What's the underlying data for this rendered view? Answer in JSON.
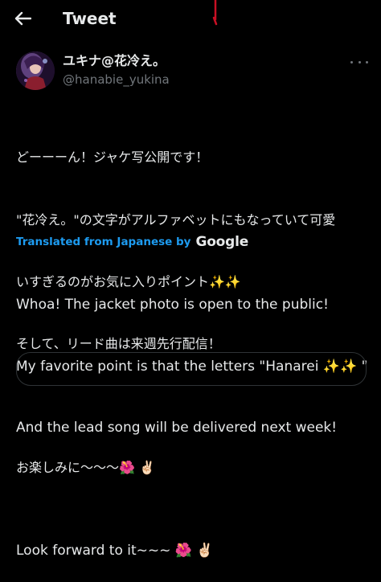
{
  "header": {
    "title": "Tweet",
    "back_icon": "arrow-left-icon"
  },
  "author": {
    "display_name": "ユキナ@花冷え。",
    "handle": "@hanabie_yukina"
  },
  "tweet": {
    "original_lines": [
      "どーーーん！ジャケ写公開です！",
      "\"花冷え。\"の文字がアルファベットにもなっていて可愛",
      "いすぎるのがお気に入りポイント✨✨",
      "そして、リード曲は来週先行配信！",
      "",
      "お楽しみに〜〜〜🌺 ✌🏻"
    ],
    "translated_label": "Translated from Japanese by",
    "translator": "Google",
    "translated_lines": [
      "Whoa! The jacket photo is open to the public!",
      "My favorite point is that the letters \"Hanarei ✨✨ \"",
      "And the lead song will be delivered next week!",
      "",
      "Look forward to it~~~ 🌺 ✌🏻"
    ]
  },
  "colors": {
    "background": "#000000",
    "text": "#e7e9ea",
    "secondary": "#71767b",
    "accent": "#1d9bf0"
  }
}
